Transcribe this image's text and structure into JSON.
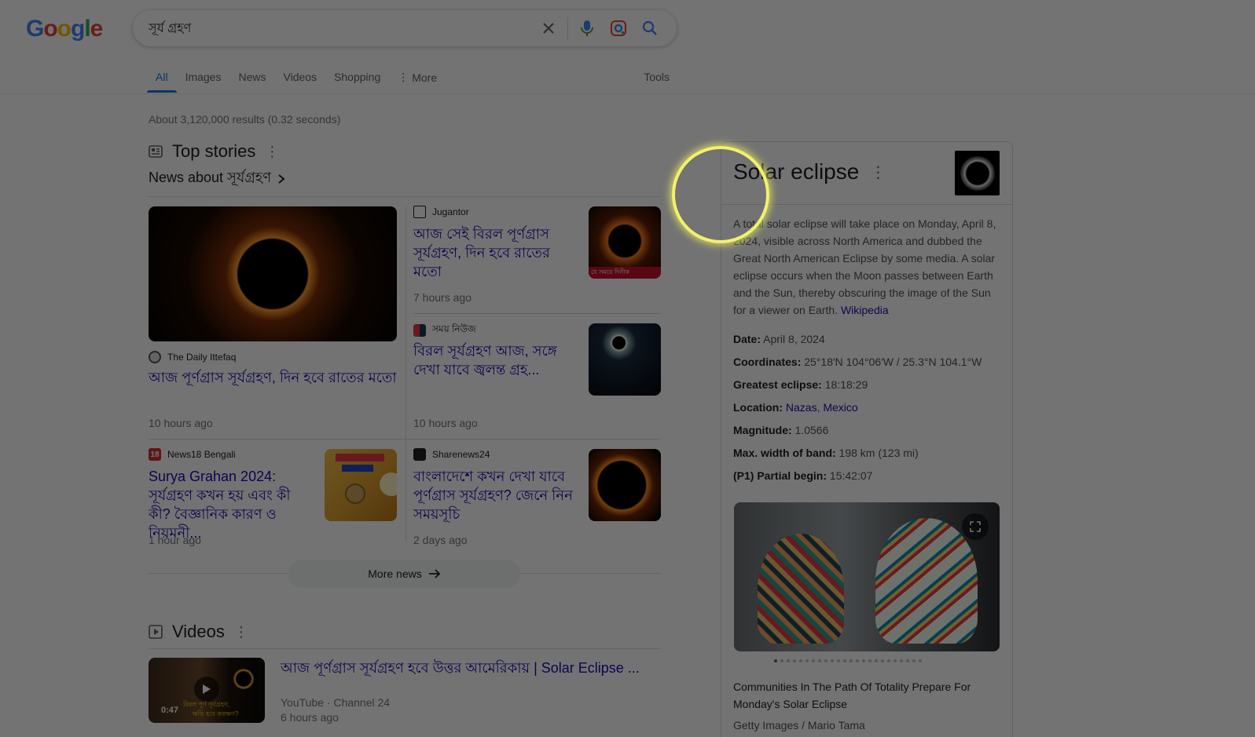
{
  "header": {
    "logo": "Google",
    "query": "সূর্য গ্রহণ"
  },
  "tabs": [
    {
      "label": "All"
    },
    {
      "label": "Images"
    },
    {
      "label": "News"
    },
    {
      "label": "Videos"
    },
    {
      "label": "Shopping"
    },
    {
      "label": "More"
    },
    {
      "label": "Tools"
    }
  ],
  "result_stats": "About 3,120,000 results (0.32 seconds)",
  "top_stories": {
    "title": "Top stories",
    "news_about": "News about সূর্যগ্রহণ",
    "more_news": "More news",
    "stories": [
      {
        "source": "The Daily Ittefaq",
        "headline": "আজ পূর্ণগ্রাস সূর্যগ্রহণ, দিন হবে রাতের মতো",
        "time": "10 hours ago"
      },
      {
        "source": "Jugantor",
        "headline": "আজ সেই বিরল পূর্ণগ্রাস সূর্যগ্রহণ, দিন হবে রাতের মতো",
        "time": "7 hours ago",
        "thumb_caption": "যে সময়ে দিনীক"
      },
      {
        "source": "সময় নিউজ",
        "headline": "বিরল সূর্যগ্রহণ আজ, সঙ্গে দেখা যাবে জ্বলন্ত গ্রহ...",
        "time": "10 hours ago"
      },
      {
        "source": "News18 Bengali",
        "headline": "Surya Grahan 2024: সূর্যগ্রহণ কখন হয় এবং কী কী? বৈজ্ঞানিক কারণ ও নিয়মনী...",
        "time": "1 hour ago",
        "source_badge": "18"
      },
      {
        "source": "Sharenews24",
        "headline": "বাংলাদেশে কখন দেখা যাবে পূর্ণগ্রাস সূর্যগ্রহণ? জেনে নিন সময়সূচি",
        "time": "2 days ago"
      }
    ]
  },
  "videos": {
    "title": "Videos",
    "items": [
      {
        "title": "আজ পূর্ণগ্রাস সূর্যগ্রহণ হবে উত্তর আমেরিকায় | Solar Eclipse ...",
        "source": "YouTube · Channel 24",
        "time": "6 hours ago",
        "duration": "0:47",
        "thumb_caption_1": "বিরল পূর্ণ সূর্যগ্রহণ,",
        "thumb_caption_2": "ক্ষতি হবে কতক্ষণ?"
      }
    ]
  },
  "knowledge_panel": {
    "title": "Solar eclipse",
    "description": "A total solar eclipse will take place on Monday, April 8, 2024, visible across North America and dubbed the Great North American Eclipse by some media. A solar eclipse occurs when the Moon passes between Earth and the Sun, thereby obscuring the image of the Sun for a viewer on Earth.",
    "description_link": "Wikipedia",
    "facts": {
      "date_label": "Date:",
      "date_value": "April 8, 2024",
      "coord_label": "Coordinates:",
      "coord_value": "25°18′N 104°06′W / 25.3°N 104.1°W",
      "greatest_label": "Greatest eclipse:",
      "greatest_value": "18:18:29",
      "location_label": "Location:",
      "location_value_1": "Nazas",
      "location_sep": ", ",
      "location_value_2": "Mexico",
      "magnitude_label": "Magnitude:",
      "magnitude_value": "1.0566",
      "band_label": "Max. width of band:",
      "band_value": "198 km (123 mi)",
      "partial_label": "(P1) Partial begin:",
      "partial_value": "15:42:07"
    },
    "photo_caption": "Communities In The Path Of Totality Prepare For Monday's Solar Eclipse",
    "photo_credit": "Getty Images / Mario Tama",
    "carousel_dots": 24,
    "carousel_active": 0
  },
  "colors": {
    "link": "#1a0dab",
    "accent": "#1a73e8",
    "spotlight": "#f2f26a"
  }
}
